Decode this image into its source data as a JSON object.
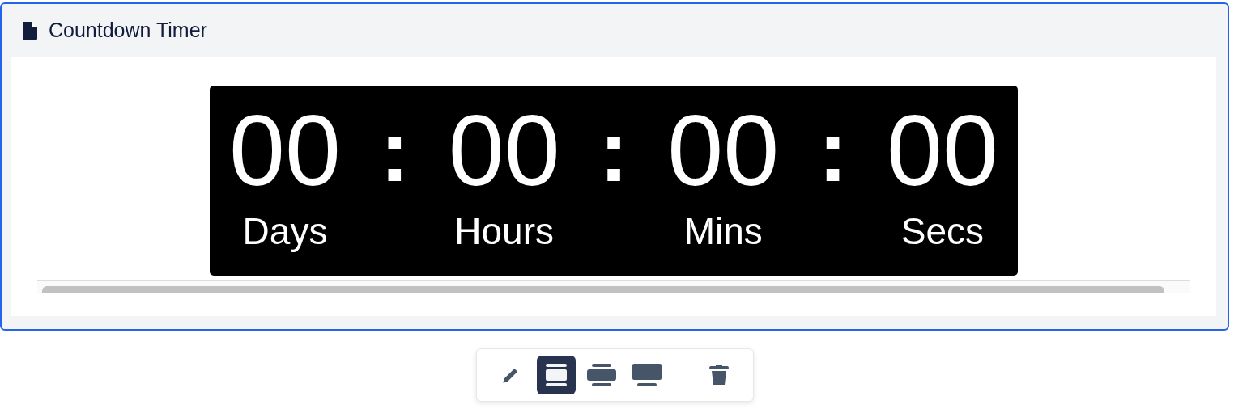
{
  "block": {
    "title": "Countdown Timer",
    "selected": true
  },
  "timer": {
    "units": [
      {
        "value": "00",
        "label": "Days"
      },
      {
        "value": "00",
        "label": "Hours"
      },
      {
        "value": "00",
        "label": "Mins"
      },
      {
        "value": "00",
        "label": "Secs"
      }
    ],
    "separator": ":"
  },
  "toolbar": [
    {
      "kind": "edit",
      "selected": false
    },
    {
      "kind": "layout-contained",
      "selected": true
    },
    {
      "kind": "layout-wide",
      "selected": false
    },
    {
      "kind": "layout-full",
      "selected": false
    },
    {
      "kind": "divider"
    },
    {
      "kind": "delete",
      "selected": false
    }
  ]
}
